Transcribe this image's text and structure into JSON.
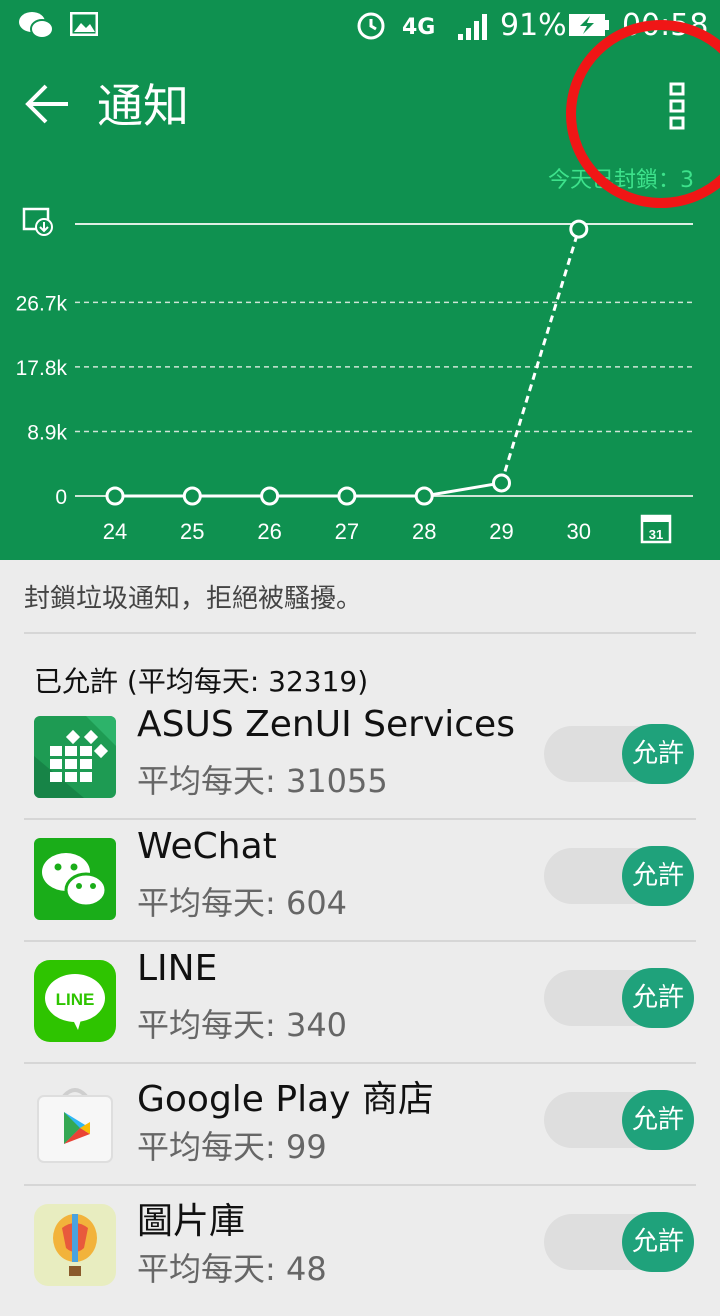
{
  "status_bar": {
    "battery": "91%",
    "time": "00:58",
    "network": "4G"
  },
  "header": {
    "title": "通知",
    "blocked_today": "今天已封鎖：3"
  },
  "chart_data": {
    "type": "line",
    "categories": [
      "24",
      "25",
      "26",
      "27",
      "28",
      "29",
      "30"
    ],
    "values": [
      0,
      0,
      0,
      0,
      0,
      1800,
      36800
    ],
    "yticks": [
      "0",
      "8.9k",
      "17.8k",
      "26.7k"
    ],
    "ylim": [
      0,
      37500
    ],
    "grid": true
  },
  "description": "封鎖垃圾通知，拒絕被騷擾。",
  "section_label": "已允許 (平均每天: 32319)",
  "apps": [
    {
      "name": "ASUS ZenUI Services",
      "avg": "平均每天: 31055",
      "state": "允許"
    },
    {
      "name": "WeChat",
      "avg": "平均每天: 604",
      "state": "允許"
    },
    {
      "name": "LINE",
      "avg": "平均每天: 340",
      "state": "允許"
    },
    {
      "name": "Google Play 商店",
      "avg": "平均每天: 99",
      "state": "允許"
    },
    {
      "name": "圖片庫",
      "avg": "平均每天: 48",
      "state": "允許"
    }
  ],
  "colors": {
    "header": "#0f9150",
    "accent": "#1fa27b",
    "annotation": "#f01616"
  }
}
